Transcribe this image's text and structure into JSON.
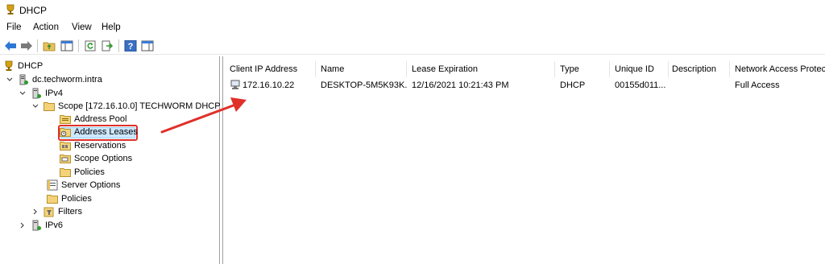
{
  "window": {
    "title": "DHCP"
  },
  "menu": {
    "items": [
      "File",
      "Action",
      "View",
      "Help"
    ]
  },
  "toolbar": {
    "buttons": [
      "back-arrow-icon",
      "forward-arrow-icon",
      "folder-up-icon",
      "show-hide-tree-icon",
      "refresh-icon",
      "export-list-icon",
      "help-icon",
      "properties-icon"
    ]
  },
  "tree": {
    "root": "DHCP",
    "server": "dc.techworm.intra",
    "ipv4": "IPv4",
    "scope": "Scope [172.16.10.0] TECHWORM DHCP",
    "address_pool": "Address Pool",
    "address_leases": "Address Leases",
    "reservations": "Reservations",
    "scope_options": "Scope Options",
    "scope_policies": "Policies",
    "server_options": "Server Options",
    "policies": "Policies",
    "filters": "Filters",
    "ipv6": "IPv6"
  },
  "table": {
    "columns": [
      "Client IP Address",
      "Name",
      "Lease Expiration",
      "Type",
      "Unique ID",
      "Description",
      "Network Access Protec"
    ],
    "rows": [
      {
        "client_ip": "172.16.10.22",
        "name": "DESKTOP-5M5K93K...",
        "lease_expiration": "12/16/2021 10:21:43 PM",
        "type": "DHCP",
        "unique_id": "00155d011...",
        "description": "",
        "nap": "Full Access"
      }
    ]
  },
  "colors": {
    "highlight_border": "#e0302a",
    "annotation_arrow": "#e0302a",
    "selection_fill": "#cce8ff"
  }
}
